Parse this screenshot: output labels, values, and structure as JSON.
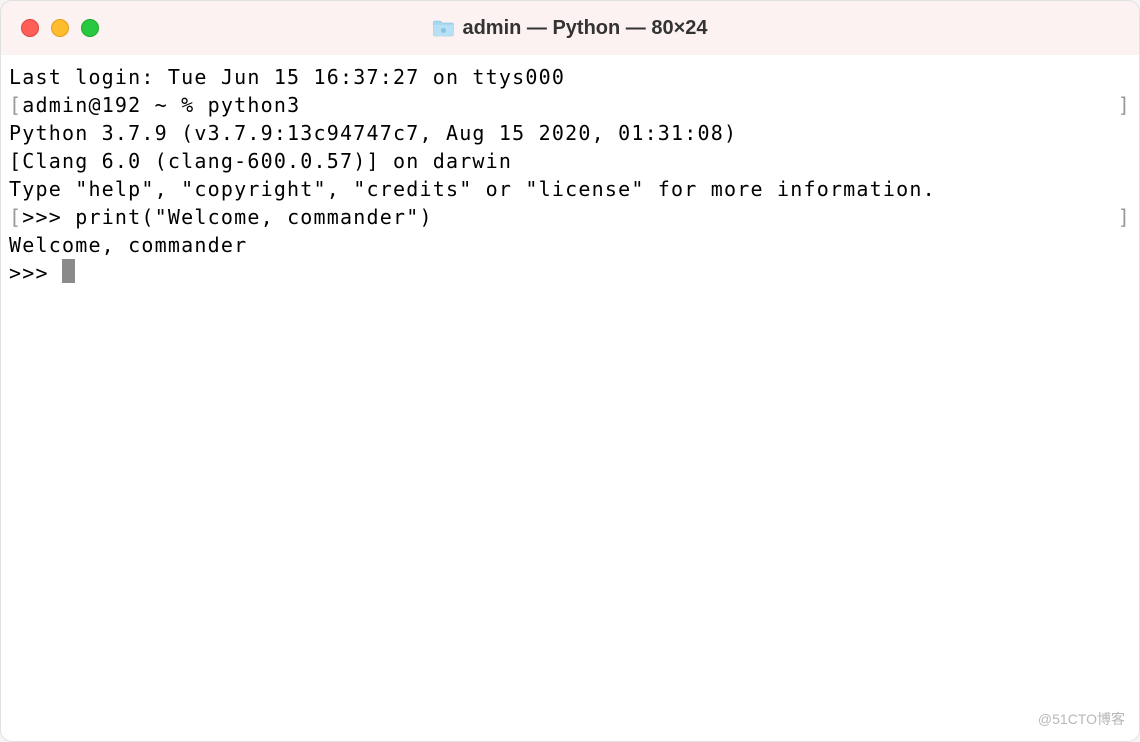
{
  "titlebar": {
    "title": "admin — Python — 80×24"
  },
  "terminal": {
    "lines": {
      "last_login": "Last login: Tue Jun 15 16:37:27 on ttys000",
      "shell_prompt": "admin@192 ~ % python3",
      "python_version": "Python 3.7.9 (v3.7.9:13c94747c7, Aug 15 2020, 01:31:08)",
      "clang": "[Clang 6.0 (clang-600.0.57)] on darwin",
      "help": "Type \"help\", \"copyright\", \"credits\" or \"license\" for more information.",
      "repl_cmd": ">>> print(\"Welcome, commander\")",
      "output": "Welcome, commander",
      "repl_prompt": ">>> "
    }
  },
  "watermark": "@51CTO博客"
}
